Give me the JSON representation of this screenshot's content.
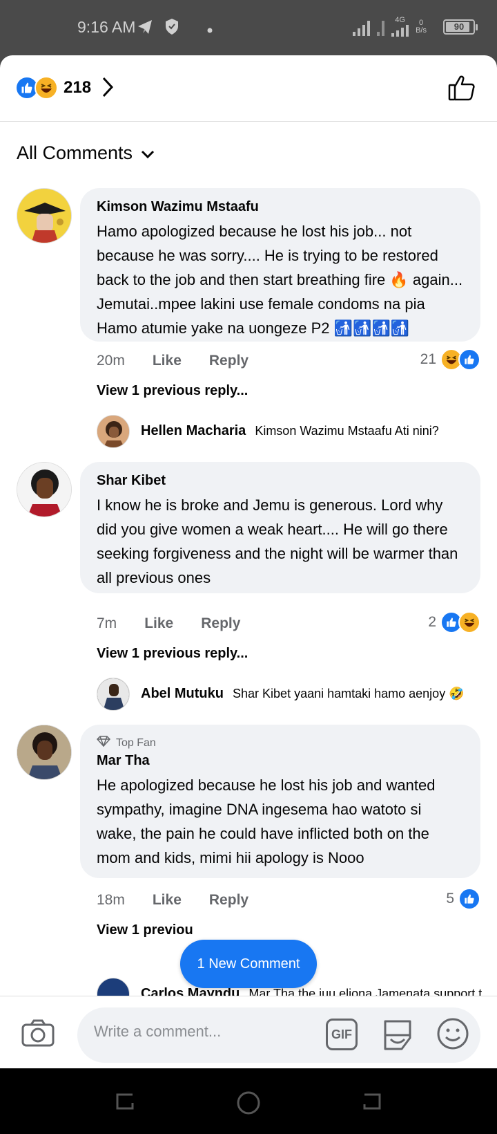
{
  "status_bar": {
    "time": "9:16 AM",
    "network": "4G",
    "speed_top": "0",
    "speed_unit": "B/s",
    "battery": "90",
    "icons": [
      "telegram-icon",
      "shield-icon",
      "dot-icon",
      "signal-icon",
      "signal-icon",
      "battery-icon"
    ]
  },
  "header": {
    "reaction_count": "218",
    "reaction_icons": [
      "like-icon",
      "haha-icon"
    ],
    "chevron": "chevron-right-icon",
    "like_button_icon": "thumbs-up-outline-icon"
  },
  "sort": {
    "label": "All Comments"
  },
  "comments": [
    {
      "author": "Kimson Wazimu Mstaafu",
      "text": "Hamo apologized because he lost his job... not because he was sorry.... He is trying to be restored back to the job and then start breathing fire 🔥 again... Jemutai..mpee lakini use female condoms na pia Hamo atumie yake na uongeze P2 🚮🚮🚮🚮",
      "time": "20m",
      "like": "Like",
      "reply": "Reply",
      "reactions": "21",
      "view_previous": "View 1 previous reply...",
      "reply_preview": {
        "author": "Hellen Macharia",
        "text": "Kimson Wazimu Mstaafu Ati nini?"
      }
    },
    {
      "author": "Shar Kibet",
      "text": "I know he is broke and Jemu is generous. Lord why did you give women a weak heart.... He will go there seeking forgiveness and the night will be warmer than all previous ones",
      "time": "7m",
      "like": "Like",
      "reply": "Reply",
      "reactions": "2",
      "view_previous": "View 1 previous reply...",
      "reply_preview": {
        "author": "Abel Mutuku",
        "text": "Shar Kibet yaani hamtaki hamo aenjoy 🤣"
      }
    },
    {
      "badge": "Top Fan",
      "author": "Mar Tha",
      "text": "He apologized because he lost his job and wanted sympathy,  imagine DNA ingesema hao watoto si wake, the pain he could have inflicted both on the mom and kids, mimi hii apology is Nooo",
      "time": "18m",
      "like": "Like",
      "reply": "Reply",
      "reactions": "5",
      "view_previous": "View 1 previou",
      "reply_preview": {
        "author": "Carlos Mayndu",
        "text": "Mar Tha the juu eliona Jamenata support t..."
      }
    }
  ],
  "new_comment_label": "1 New Comment",
  "composer": {
    "placeholder": "Write a comment...",
    "gif_label": "GIF"
  },
  "colors": {
    "accent": "#1877f2",
    "bubble": "#f0f2f5",
    "meta_text": "#65676b",
    "haha": "#f7b125"
  }
}
